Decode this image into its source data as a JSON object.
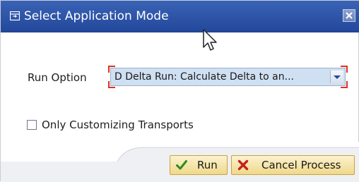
{
  "window": {
    "title": "Select Application Mode"
  },
  "form": {
    "run_option_label": "Run Option",
    "run_option_value": "D Delta Run: Calculate Delta to an...",
    "checkbox_label": "Only Customizing Transports",
    "checkbox_checked": false
  },
  "buttons": {
    "run_label": "Run",
    "cancel_label": "Cancel Process"
  },
  "colors": {
    "title_bar": "#2a52a6",
    "dropdown_fill": "#cfe0f2",
    "required_marker": "#d9332b",
    "button_fill": "#f4e2a6"
  },
  "icons": {
    "title": "window-mode-icon",
    "close": "close-icon",
    "run": "checkmark-icon",
    "cancel": "cancel-x-icon",
    "dropdown": "chevron-down-icon",
    "cursor": "mouse-pointer-icon"
  }
}
